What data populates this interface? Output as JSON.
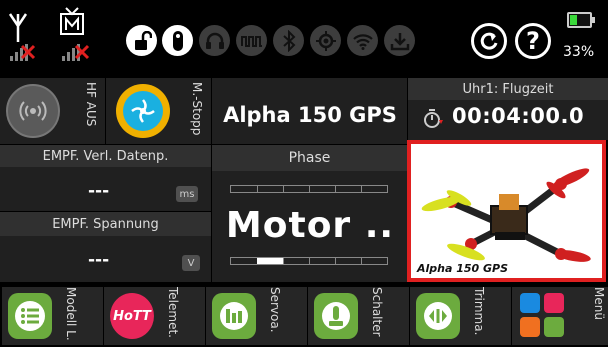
{
  "statusbar": {
    "battery_pct": "33%",
    "battery_level": 0.33,
    "icons": [
      "antenna-icon",
      "tv-receiver-icon",
      "unlock-icon",
      "info-icon",
      "headphones-icon",
      "servo-pulse-icon",
      "bluetooth-icon",
      "gps-icon",
      "wifi-icon",
      "download-icon",
      "reset-icon",
      "help-icon"
    ]
  },
  "row1": {
    "hf_label": "HF AUS",
    "motor_stop_label": "M.-Stopp",
    "model_name": "Alpha 150 GPS",
    "timer_label": "Uhr1: Flugzeit",
    "timer_value": "00:04:00.0"
  },
  "telemetry": {
    "loss_label": "EMPF. Verl. Datenp.",
    "loss_value": "---",
    "loss_unit": "ms",
    "voltage_label": "EMPF. Spannung",
    "voltage_value": "---",
    "voltage_unit": "V"
  },
  "phase": {
    "label": "Phase",
    "value": "Motor .."
  },
  "model_image": {
    "caption": "Alpha 150 GPS"
  },
  "bottombar": {
    "items": [
      {
        "label": "Modell L.",
        "icon": "list-icon"
      },
      {
        "label": "Telemet.",
        "icon": "hott-logo-icon"
      },
      {
        "label": "Servoa.",
        "icon": "servo-monitor-icon"
      },
      {
        "label": "Schalter",
        "icon": "switch-icon"
      },
      {
        "label": "Trimma.",
        "icon": "trim-icon"
      },
      {
        "label": "Menü",
        "icon": "menu-grid-icon"
      }
    ]
  },
  "colors": {
    "accent_red": "#e02020",
    "green": "#6cab3e",
    "hott_red": "#e8265a",
    "battery_green": "#3bd93b"
  }
}
